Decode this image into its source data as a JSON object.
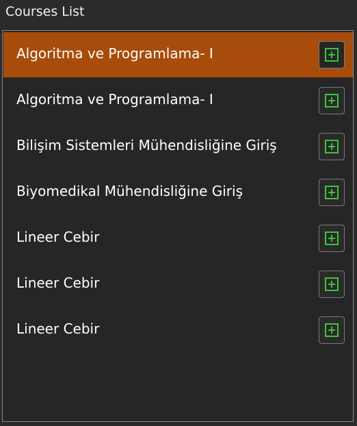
{
  "window": {
    "title": "Courses List"
  },
  "courses": {
    "add_icon": "plus-square-icon",
    "accent_color": "#a84c0c",
    "icon_color": "#3cc43c",
    "selected_index": 0,
    "items": [
      {
        "label": "Algoritma ve Programlama- I"
      },
      {
        "label": "Algoritma ve Programlama- I"
      },
      {
        "label": "Bilişim Sistemleri Mühendisliğine Giriş"
      },
      {
        "label": "Biyomedikal Mühendisliğine Giriş"
      },
      {
        "label": "Lineer Cebir"
      },
      {
        "label": "Lineer Cebir"
      },
      {
        "label": "Lineer Cebir"
      }
    ]
  }
}
